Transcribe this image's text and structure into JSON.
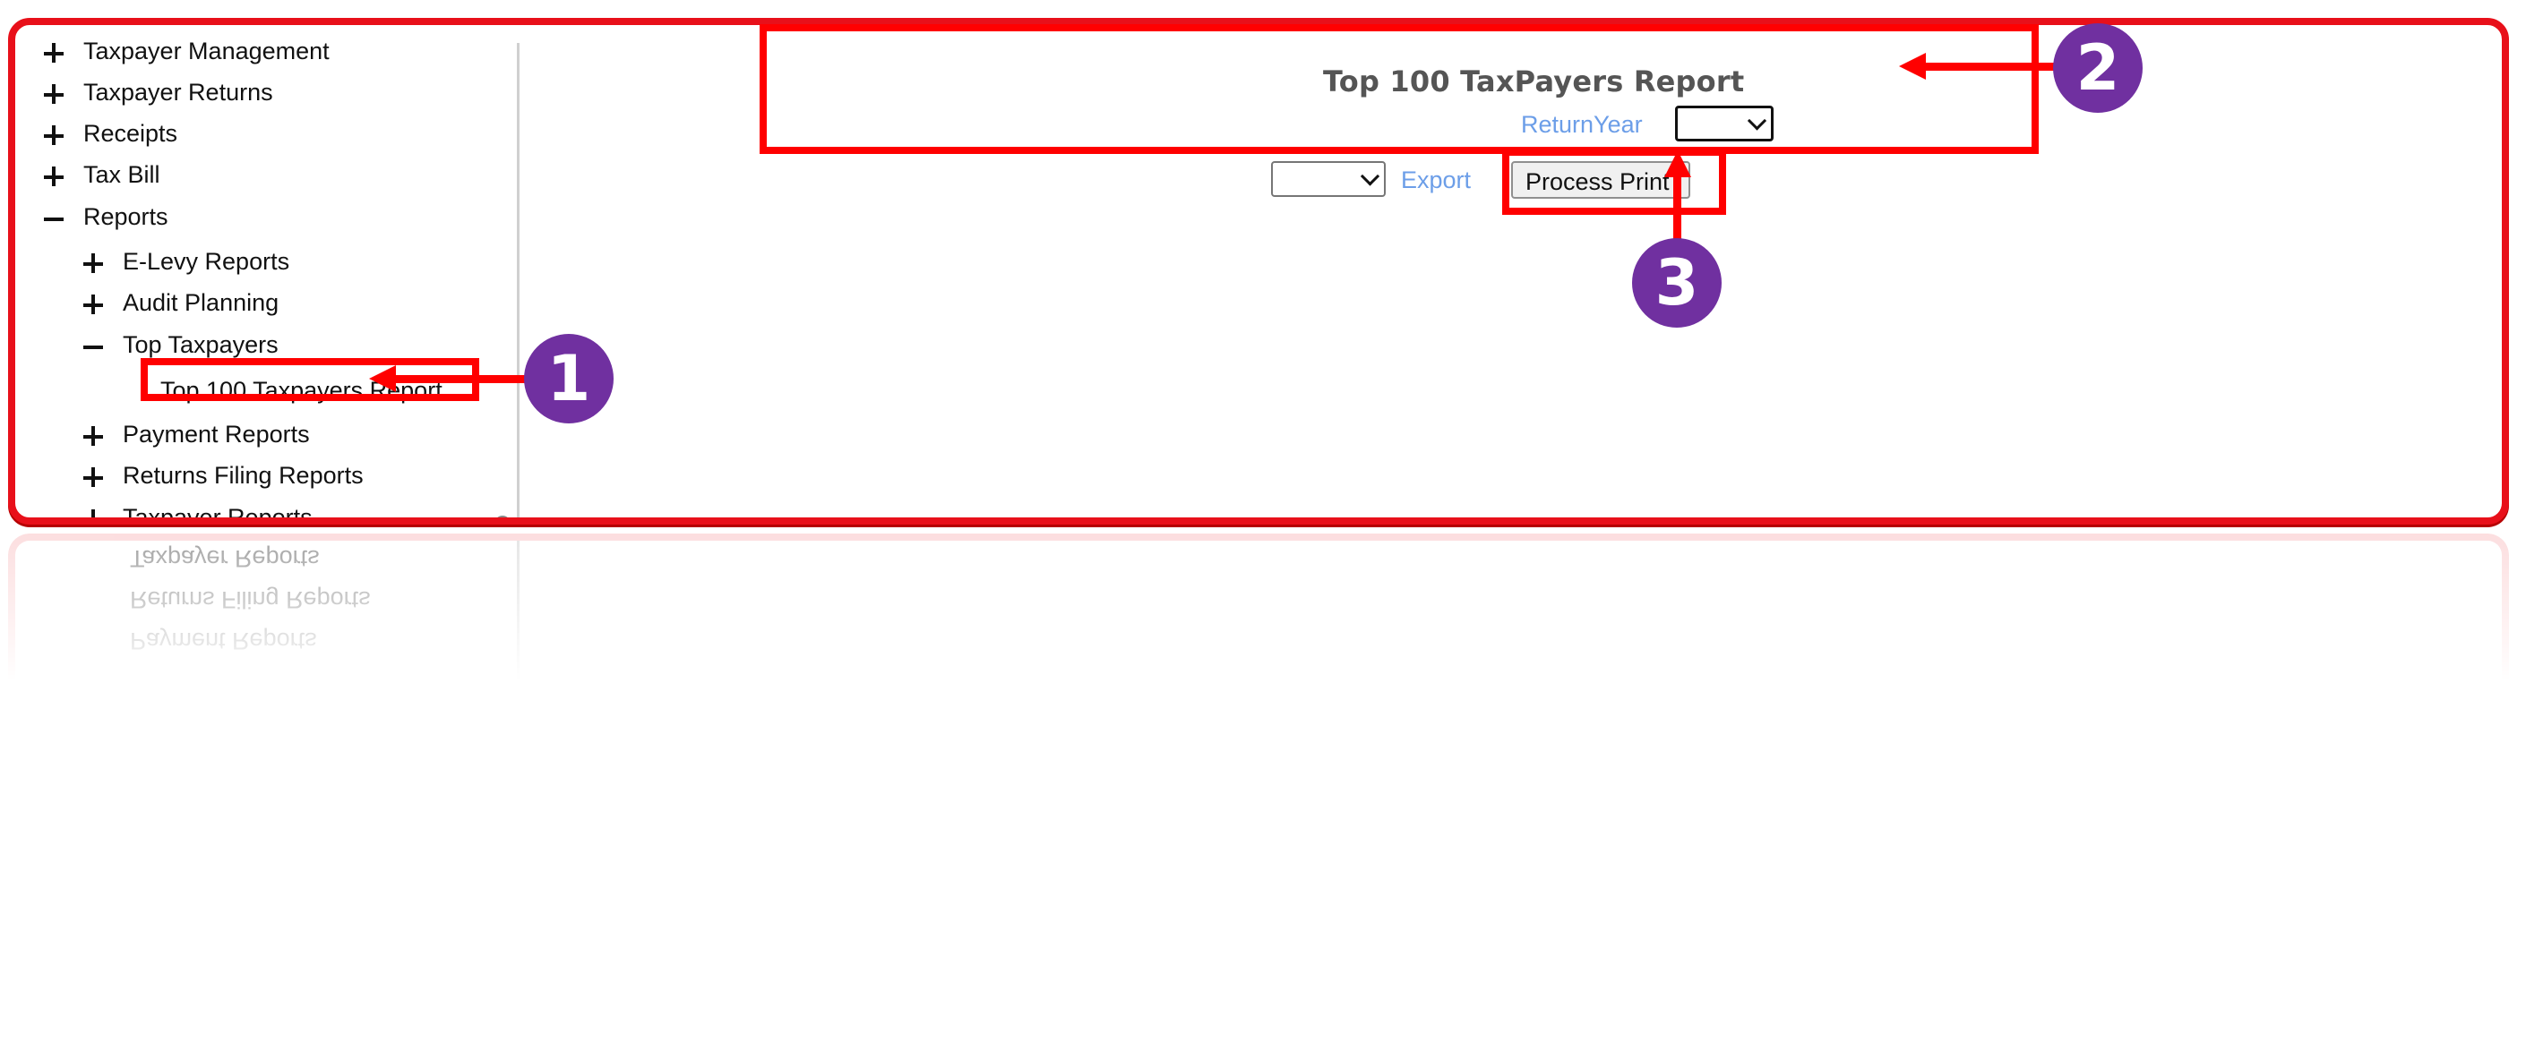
{
  "sidebar": {
    "items": [
      {
        "label": "Taxpayer Management",
        "state": "collapsed"
      },
      {
        "label": "Taxpayer Returns",
        "state": "collapsed"
      },
      {
        "label": "Receipts",
        "state": "collapsed"
      },
      {
        "label": "Tax Bill",
        "state": "collapsed"
      },
      {
        "label": "Reports",
        "state": "expanded"
      },
      {
        "label": "E-Levy Reports",
        "state": "collapsed"
      },
      {
        "label": "Audit Planning",
        "state": "collapsed"
      },
      {
        "label": "Top Taxpayers",
        "state": "expanded"
      },
      {
        "label": "Top 100 Taxpayers Report",
        "state": "leaf"
      },
      {
        "label": "Payment Reports",
        "state": "collapsed"
      },
      {
        "label": "Returns Filing Reports",
        "state": "collapsed"
      },
      {
        "label": "Taxpayer Reports",
        "state": "collapsed"
      }
    ]
  },
  "report": {
    "title": "Top 100 TaxPayers Report",
    "return_year_label": "ReturnYear",
    "return_year_value": "",
    "export_format_value": "",
    "export_label": "Export",
    "process_button_label": "Process Print"
  },
  "annotations": {
    "badges": [
      "1",
      "2",
      "3"
    ],
    "color_box": "#ff0000",
    "color_badge": "#7030a0"
  },
  "icons": {
    "collapsed": "plus-icon",
    "expanded": "minus-icon",
    "dropdown": "chevron-down-icon"
  }
}
